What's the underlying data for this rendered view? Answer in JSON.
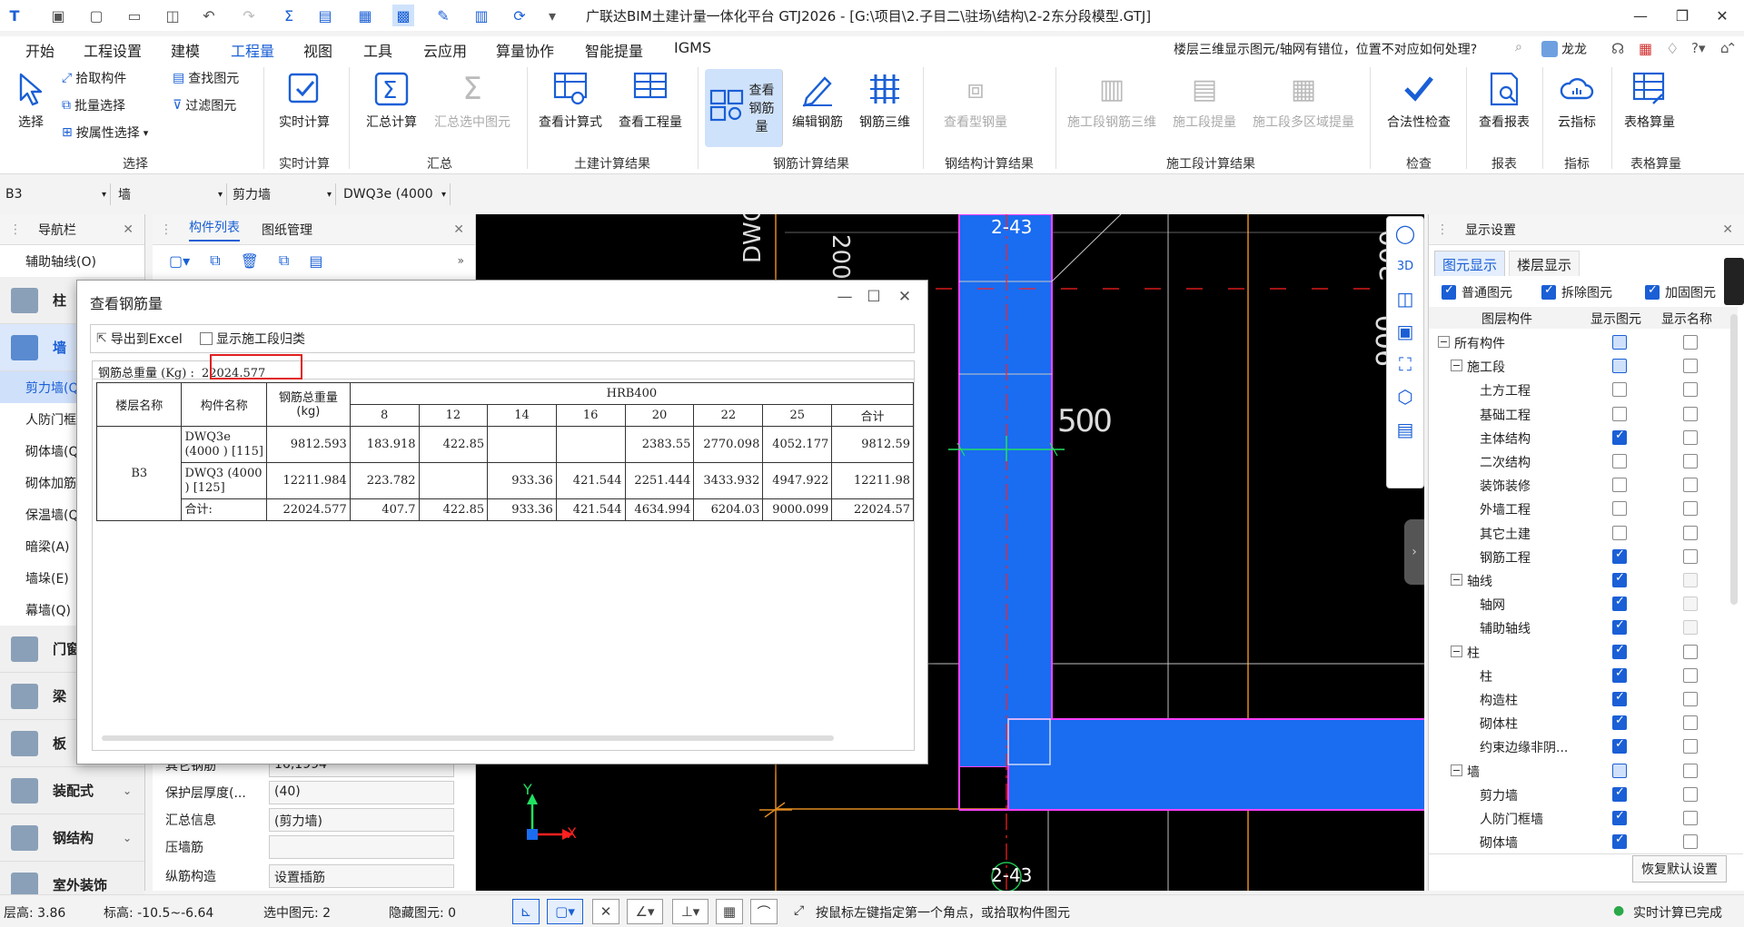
{
  "app": {
    "title": "广联达BIM土建计量一体化平台 GTJ2026 - [G:\\项目\\2.子目二\\驻场\\结构\\2-2东分段模型.GTJ]",
    "user": "龙龙",
    "help_search": "楼层三维显示图元/轴网有错位，位置不对应如何处理?"
  },
  "menu": [
    "开始",
    "工程设置",
    "建模",
    "工程量",
    "视图",
    "工具",
    "云应用",
    "算量协作",
    "智能提量",
    "IGMS"
  ],
  "menu_active": "工程量",
  "ribbon": {
    "select": {
      "big": "选择",
      "small": [
        "拾取构件",
        "批量选择",
        "按属性选择",
        "查找图元",
        "过滤图元"
      ],
      "group": "选择"
    },
    "realtime": {
      "btn": "实时计算",
      "group": "实时计算"
    },
    "summary": {
      "btns": [
        "汇总计算",
        "汇总选中图元"
      ],
      "group": "汇总"
    },
    "civil": {
      "btns": [
        "查看计算式",
        "查看工程量"
      ],
      "group": "土建计算结果"
    },
    "rebar": {
      "btns": [
        "查看钢筋量",
        "编辑钢筋",
        "钢筋三维"
      ],
      "group": "钢筋计算结果"
    },
    "steel": {
      "btns": [
        "查看型钢量"
      ],
      "group": "钢结构计算结果"
    },
    "stage": {
      "btns": [
        "施工段钢筋三维",
        "施工段提量",
        "施工段多区域提量"
      ],
      "group": "施工段计算结果"
    },
    "check": {
      "btns": [
        "合法性检查"
      ],
      "group": "检查"
    },
    "report": {
      "btns": [
        "查看报表"
      ],
      "group": "报表"
    },
    "index": {
      "btns": [
        "云指标"
      ],
      "group": "指标"
    },
    "table": {
      "btns": [
        "表格算量"
      ],
      "group": "表格算量"
    }
  },
  "selectors": [
    "B3",
    "墙",
    "剪力墙",
    "DWQ3e (4000"
  ],
  "nav": {
    "title": "导航栏",
    "top_item": "辅助轴线(O)",
    "col": "柱",
    "wall": "墙",
    "wall_items": [
      "剪力墙(Q)",
      "人防门框墙",
      "砌体墙(Q)",
      "砌体加筋",
      "保温墙(Q)",
      "暗梁(A)",
      "墙垛(E)",
      "幕墙(Q)"
    ],
    "others": [
      "门窗洞",
      "梁",
      "板",
      "装配式",
      "钢结构",
      "室外装饰"
    ]
  },
  "complist": {
    "tabs": [
      "构件列表",
      "图纸管理"
    ],
    "props": [
      {
        "name": "其它钢筋",
        "value": "16,1994"
      },
      {
        "name": "保护层厚度(...",
        "value": "(40)"
      },
      {
        "name": "汇总信息",
        "value": "(剪力墙)"
      },
      {
        "name": "压墙筋",
        "value": ""
      },
      {
        "name": "纵筋构造",
        "value": "设置插筋"
      }
    ]
  },
  "canvas": {
    "labels": [
      "2-43",
      "2-43",
      "DWQ3",
      "200",
      "500",
      "200",
      "900",
      "Y",
      "X"
    ]
  },
  "display": {
    "title": "显示设置",
    "tabs": [
      "图元显示",
      "楼层显示"
    ],
    "top_checks": [
      "普通图元",
      "拆除图元",
      "加固图元"
    ],
    "cols": [
      "图层构件",
      "显示图元",
      "显示名称"
    ],
    "rows": [
      {
        "label": "所有构件",
        "lvl": 0,
        "tog": "−",
        "show": "part",
        "name": "off"
      },
      {
        "label": "施工段",
        "lvl": 1,
        "tog": "−",
        "show": "part",
        "name": "off"
      },
      {
        "label": "土方工程",
        "lvl": 2,
        "show": "off",
        "name": "off"
      },
      {
        "label": "基础工程",
        "lvl": 2,
        "show": "off",
        "name": "off"
      },
      {
        "label": "主体结构",
        "lvl": 2,
        "show": "on",
        "name": "off"
      },
      {
        "label": "二次结构",
        "lvl": 2,
        "show": "off",
        "name": "off"
      },
      {
        "label": "装饰装修",
        "lvl": 2,
        "show": "off",
        "name": "off"
      },
      {
        "label": "外墙工程",
        "lvl": 2,
        "show": "off",
        "name": "off"
      },
      {
        "label": "其它土建",
        "lvl": 2,
        "show": "off",
        "name": "off"
      },
      {
        "label": "钢筋工程",
        "lvl": 2,
        "show": "on",
        "name": "off"
      },
      {
        "label": "轴线",
        "lvl": 1,
        "tog": "−",
        "show": "on",
        "name": "dim"
      },
      {
        "label": "轴网",
        "lvl": 2,
        "show": "on",
        "name": "dim"
      },
      {
        "label": "辅助轴线",
        "lvl": 2,
        "show": "on",
        "name": "dim"
      },
      {
        "label": "柱",
        "lvl": 1,
        "tog": "−",
        "show": "on",
        "name": "off"
      },
      {
        "label": "柱",
        "lvl": 2,
        "show": "on",
        "name": "off"
      },
      {
        "label": "构造柱",
        "lvl": 2,
        "show": "on",
        "name": "off"
      },
      {
        "label": "砌体柱",
        "lvl": 2,
        "show": "on",
        "name": "off"
      },
      {
        "label": "约束边缘非阴...",
        "lvl": 2,
        "show": "on",
        "name": "off"
      },
      {
        "label": "墙",
        "lvl": 1,
        "tog": "−",
        "show": "part",
        "name": "off"
      },
      {
        "label": "剪力墙",
        "lvl": 2,
        "show": "on",
        "name": "off"
      },
      {
        "label": "人防门框墙",
        "lvl": 2,
        "show": "on",
        "name": "off"
      },
      {
        "label": "砌体墙",
        "lvl": 2,
        "show": "on",
        "name": "off"
      }
    ],
    "restore": "恢复默认设置"
  },
  "status": {
    "floor_h": "层高:  3.86",
    "elev": "标高:  -10.5~-6.64",
    "selected": "选中图元:  2",
    "hidden": "隐藏图元:  0",
    "hint": "按鼠标左键指定第一个角点，或拾取构件图元",
    "calc": "实时计算已完成"
  },
  "dialog": {
    "title": "查看钢筋量",
    "export": "导出到Excel",
    "show_stage": "显示施工段归类",
    "total_label": "钢筋总重量 (Kg) :",
    "total_value": "22024.577",
    "table": {
      "h_floor": "楼层名称",
      "h_comp": "构件名称",
      "h_total": "钢筋总重量 (kg)",
      "h_grade": "HRB400",
      "diams": [
        "8",
        "12",
        "14",
        "16",
        "20",
        "22",
        "25",
        "合计"
      ],
      "rows": [
        {
          "idx": "1",
          "comp": "DWQ3e (4000 ) [115]",
          "total": "9812.593",
          "vals": [
            "183.918",
            "422.85",
            "",
            "",
            "2383.55",
            "2770.098",
            "4052.177",
            "9812.59"
          ]
        },
        {
          "idx": "2",
          "comp": "DWQ3 (4000 ) [125]",
          "total": "12211.984",
          "vals": [
            "223.782",
            "",
            "933.36",
            "421.544",
            "2251.444",
            "3433.932",
            "4947.922",
            "12211.98"
          ]
        },
        {
          "idx": "3",
          "comp": "合计:",
          "total": "22024.577",
          "vals": [
            "407.7",
            "422.85",
            "933.36",
            "421.544",
            "4634.994",
            "6204.03",
            "9000.099",
            "22024.57"
          ]
        }
      ],
      "floor": "B3"
    }
  }
}
